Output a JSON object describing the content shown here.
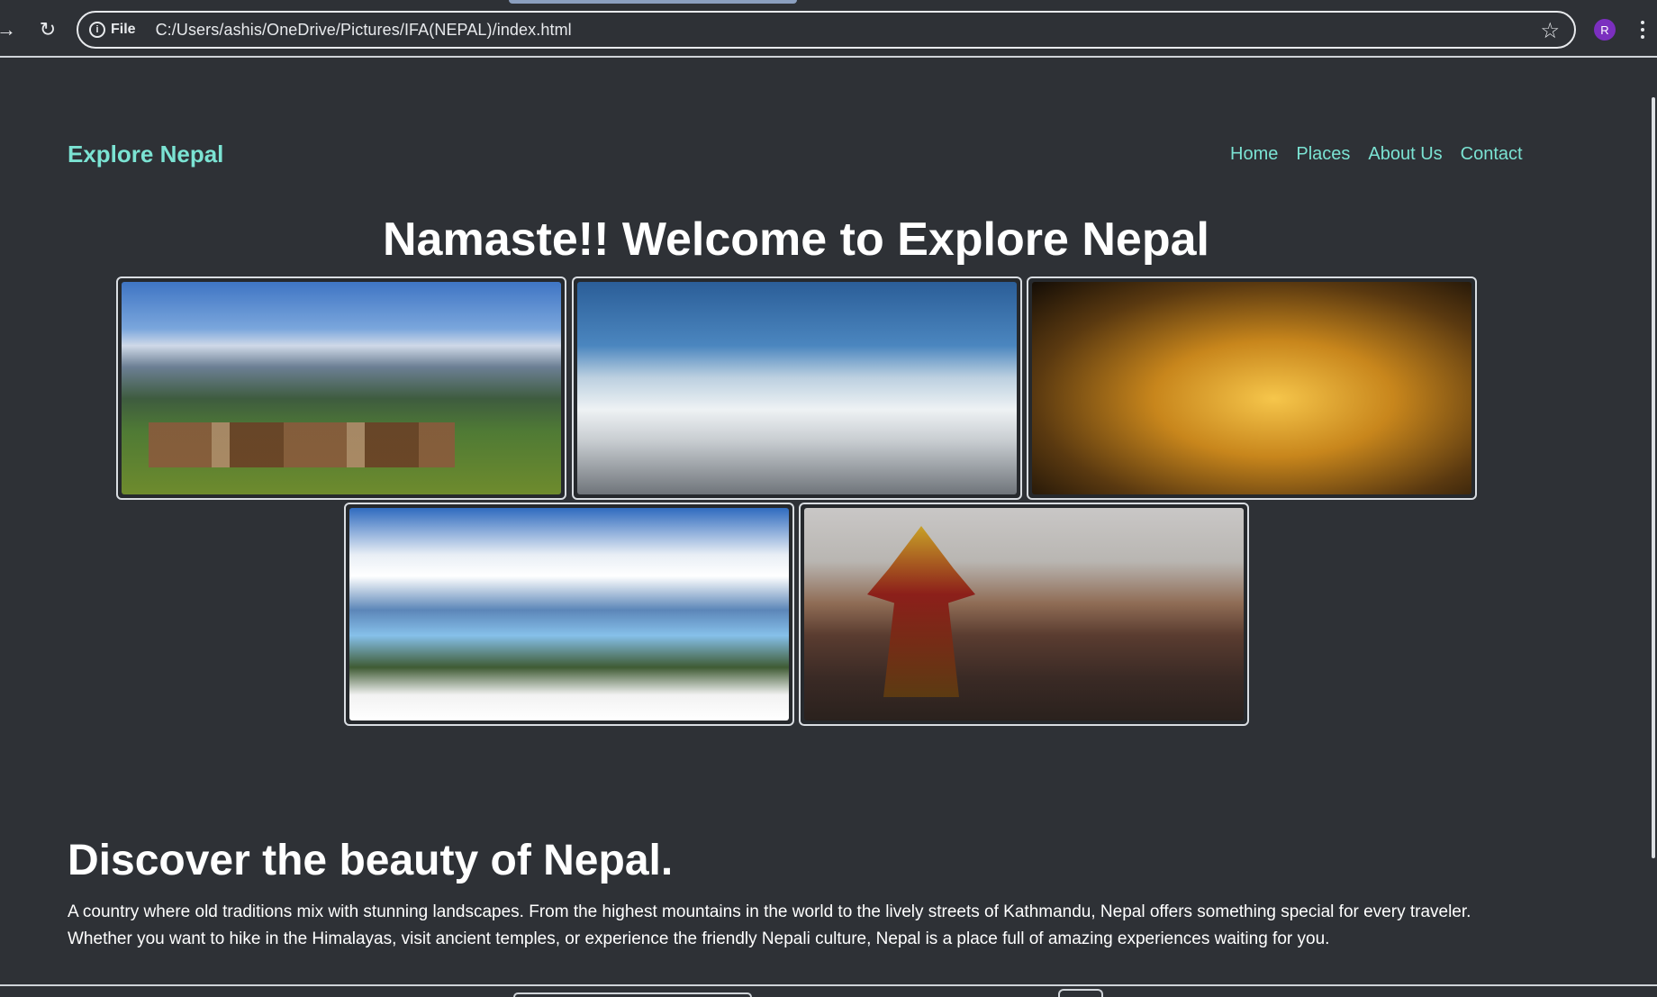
{
  "browser": {
    "address_chip": "File",
    "url": "C:/Users/ashis/OneDrive/Pictures/IFA(NEPAL)/index.html",
    "avatar_initial": "R",
    "icons": [
      "forward-icon",
      "reload-icon",
      "info-icon",
      "star-icon",
      "menu-icon"
    ]
  },
  "header": {
    "brand": "Explore Nepal",
    "nav": [
      "Home",
      "Places",
      "About Us",
      "Contact"
    ]
  },
  "hero": {
    "title": "Namaste!! Welcome to Explore Nepal"
  },
  "gallery": {
    "images": [
      {
        "subject": "mountain village with snow peaks"
      },
      {
        "subject": "snowy Himalayan peaks with birds"
      },
      {
        "subject": "temple complex at night"
      },
      {
        "subject": "mountain lake with snow"
      },
      {
        "subject": "chariot festival crowd"
      }
    ]
  },
  "about": {
    "heading": "Discover the beauty of Nepal.",
    "text": "A country where old traditions mix with stunning landscapes. From the highest mountains in the world to the lively streets of Kathmandu, Nepal offers something special for every traveler. Whether you want to hike in the Himalayas, visit ancient temples, or experience the friendly Nepali culture, Nepal is a place full of amazing experiences waiting for you."
  },
  "colors": {
    "background": "#2e3136",
    "accent": "#7be3d3",
    "text": "#ffffff"
  }
}
